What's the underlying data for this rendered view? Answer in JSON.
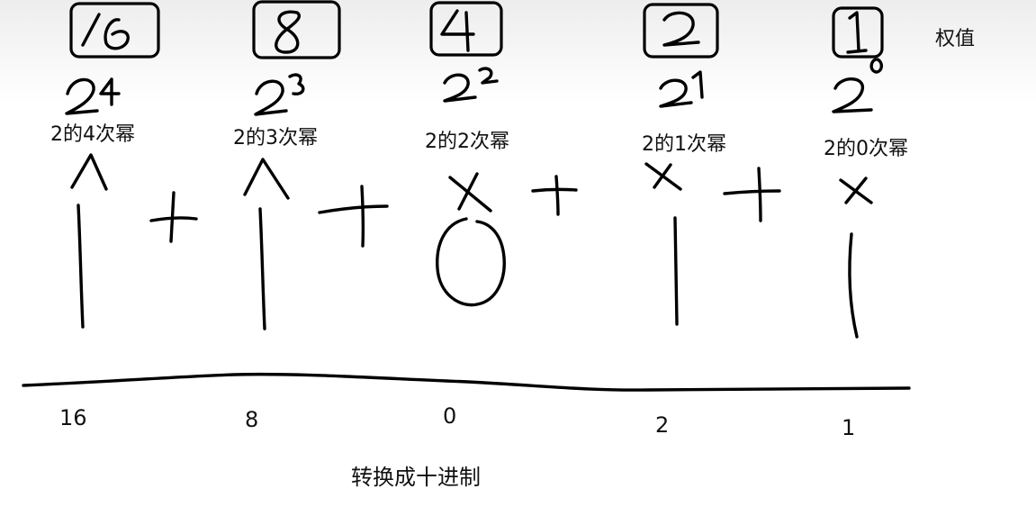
{
  "weight_label": "权值",
  "columns": [
    {
      "weight": "16",
      "base": "2",
      "exponent": "4",
      "power_label": "2的4次幂",
      "bit": "1",
      "value": "16"
    },
    {
      "weight": "8",
      "base": "2",
      "exponent": "3",
      "power_label": "2的3次幂",
      "bit": "1",
      "value": "8"
    },
    {
      "weight": "4",
      "base": "2",
      "exponent": "2",
      "power_label": "2的2次幂",
      "bit": "0",
      "value": "0"
    },
    {
      "weight": "2",
      "base": "2",
      "exponent": "1",
      "power_label": "2的1次幂",
      "bit": "1",
      "value": "2"
    },
    {
      "weight": "1",
      "base": "2",
      "exponent": "0",
      "power_label": "2的0次幂",
      "bit": "1",
      "value": "1"
    }
  ],
  "operator_multiply": "×",
  "operator_plus": "+",
  "caption": "转换成十进制",
  "colors": {
    "ink": "#000000",
    "text": "#111111",
    "top_shade": "#ededed"
  }
}
